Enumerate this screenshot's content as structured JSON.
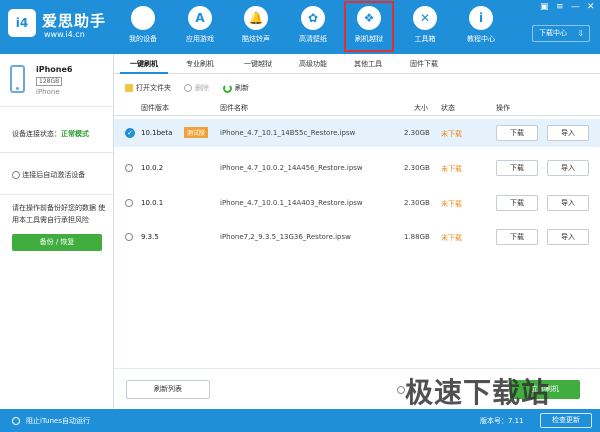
{
  "header": {
    "logo_mark": "i4",
    "logo_name": "爱思助手",
    "logo_url": "www.i4.cn",
    "download_center": "下载中心",
    "nav": [
      {
        "label": "我的设备",
        "icon": "apple-icon",
        "glyph": ""
      },
      {
        "label": "应用游戏",
        "icon": "app-store-icon",
        "glyph": "A"
      },
      {
        "label": "酷炫铃声",
        "icon": "bell-icon",
        "glyph": "🔔"
      },
      {
        "label": "高清壁纸",
        "icon": "flower-icon",
        "glyph": "✿"
      },
      {
        "label": "刷机越狱",
        "icon": "dropbox-icon",
        "glyph": "❖"
      },
      {
        "label": "工具箱",
        "icon": "tools-icon",
        "glyph": "✕"
      },
      {
        "label": "教程中心",
        "icon": "info-icon",
        "glyph": "i"
      }
    ]
  },
  "sidebar": {
    "device_name": "iPhone6",
    "capacity": "128GB",
    "device_type": "iPhone",
    "connection_label": "设备连接状态：",
    "connection_value": "正常模式",
    "auto_activate": "连接后自动激活设备",
    "warning": "请在操作前备份好您的数据 使用本工具需自行承担风险",
    "backup_button": "备份 / 恢复"
  },
  "tabs": [
    "一键刷机",
    "专业刷机",
    "一键越狱",
    "高级功能",
    "其他工具",
    "固件下载"
  ],
  "toolbar": {
    "open_folder": "打开文件夹",
    "delete": "删除",
    "refresh": "刷新"
  },
  "table": {
    "headers": [
      "固件版本",
      "固件名称",
      "大小",
      "状态",
      "操作"
    ],
    "rows": [
      {
        "version": "10.1beta",
        "badge": "测试版",
        "file": "iPhone_4.7_10.1_14B55c_Restore.ipsw",
        "size": "2.30GB",
        "status": "未下载",
        "download": "下载",
        "import": "导入",
        "selected": true
      },
      {
        "version": "10.0.2",
        "badge": "",
        "file": "iPhone_4.7_10.0.2_14A456_Restore.ipsw",
        "size": "2.30GB",
        "status": "未下载",
        "download": "下载",
        "import": "导入",
        "selected": false
      },
      {
        "version": "10.0.1",
        "badge": "",
        "file": "iPhone_4.7_10.0.1_14A403_Restore.ipsw",
        "size": "2.30GB",
        "status": "未下载",
        "download": "下载",
        "import": "导入",
        "selected": false
      },
      {
        "version": "9.3.5",
        "badge": "",
        "file": "iPhone7,2_9.3.5_13G36_Restore.ipsw",
        "size": "1.88GB",
        "status": "未下载",
        "download": "下载",
        "import": "导入",
        "selected": false
      }
    ]
  },
  "bottom": {
    "refresh_list": "刷新列表",
    "start_button": "立即刷机"
  },
  "watermark": "极速下载站",
  "statusbar": {
    "itunes": "阻止iTunes自动运行",
    "version": "版本号：7.11",
    "update": "检查更新"
  },
  "colors": {
    "brand": "#1e8fd8",
    "green": "#3fae3f",
    "orange": "#f08a1c",
    "active_border": "#e03030"
  }
}
